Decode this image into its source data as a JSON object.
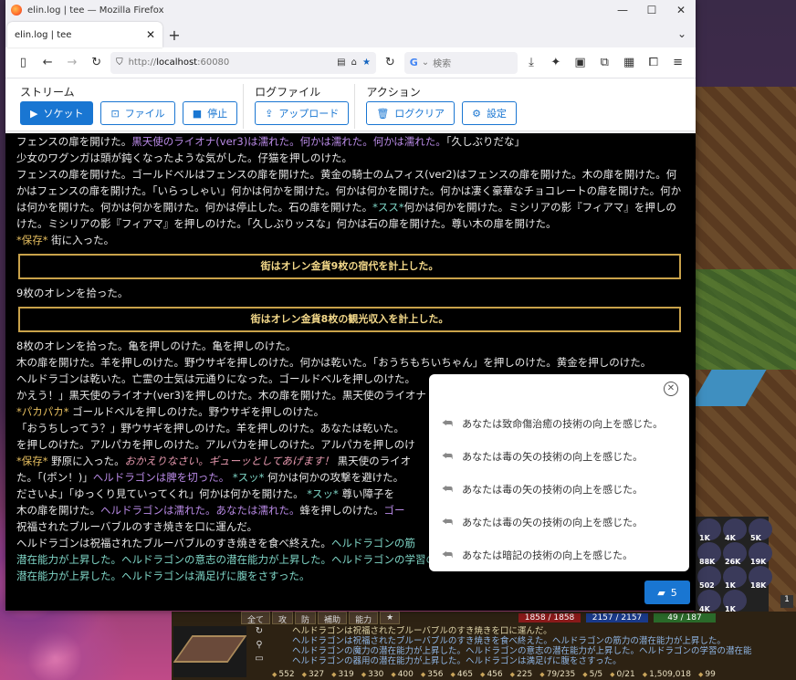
{
  "browser": {
    "window_title": "elin.log | tee — Mozilla Firefox",
    "tab_title": "elin.log | tee",
    "url_protocol": "http://",
    "url_host": "localhost",
    "url_port": ":60080",
    "search_placeholder": "検索"
  },
  "toolbar": {
    "stream": {
      "label": "ストリーム",
      "socket": "ソケット",
      "file": "ファイル",
      "stop": "停止"
    },
    "logfile": {
      "label": "ログファイル",
      "upload": "アップロード"
    },
    "action": {
      "label": "アクション",
      "clear": "ログクリア",
      "settings": "設定"
    }
  },
  "log": {
    "l1a": "フェンスの扉を開けた。",
    "l1b": "黒天使のライオナ(ver3)は濡れた。何かは濡れた。何かは濡れた。",
    "l1c": "「久しぶりだな」",
    "l2": "少女のワグンガは頭が鈍くなったような気がした。仔猫を押しのけた。",
    "l3": "フェンスの扉を開けた。ゴールドベルはフェンスの扉を開けた。黄金の騎士のムフィス(ver2)はフェンスの扉を開けた。木の扉を開けた。何かはフェンスの扉を開けた。「いらっしゃい」何かは何かを開けた。何かは何かを開けた。何かは凄く豪華なチョコレートの扉を開けた。何かは何かを開けた。何かは何かを開けた。何かは停止した。石の扉を開けた。",
    "l3b": "*スス*",
    "l3c": "何かは何かを開けた。ミシリアの影『フィアマ』を押しのけた。ミシリアの影『フィアマ』を押しのけた。「久しぶりッスな」何かは石の扉を開けた。尊い木の扉を開けた。",
    "l4a": "*保存*",
    "l4b": "街に入った。",
    "box1": "街はオレン金貨9枚の宿代を計上した。",
    "l5": "9枚のオレンを拾った。",
    "box2": "街はオレン金貨8枚の観光収入を計上した。",
    "l6": "8枚のオレンを拾った。亀を押しのけた。亀を押しのけた。",
    "l7": "木の扉を開けた。羊を押しのけた。野ウサギを押しのけた。何かは乾いた。「おうちもちいちゃん」を押しのけた。黄金を押しのけた。",
    "l7b": "ヘルドラゴンは乾いた。亡霊の士気は元通りになった。ゴールドベルを押しのけた。",
    "l8": "かえう！」黒天使のライオナ(ver3)を押しのけた。木の扉を開けた。黒天使のライオナ",
    "l9a": "*パカパカ*",
    "l9b": "ゴールドベルを押しのけた。野ウサギを押しのけた。",
    "l10": "「おうちしってう？」野ウサギを押しのけた。羊を押しのけた。あなたは乾いた。",
    "l11": "を押しのけた。アルパカを押しのけた。アルパカを押しのけた。アルパカを押しのけ",
    "l12a": "*保存*",
    "l12b": "野原に入った。",
    "l12c": "おかえりなさい。ギューッとしてあげます！",
    "l12d": "黒天使のライオ",
    "l13a": "た。「(ポン！)」",
    "l13b": "ヘルドラゴンは脾を切った。",
    "l13c": "*スッ*",
    "l13d": "何かは何かの攻撃を避けた。",
    "l14a": "ださいよ」「ゆっくり見ていってくれ」何かは何かを開けた。",
    "l14b": "*スッ*",
    "l14c": "尊い障子を",
    "l15a": "木の扉を開けた。",
    "l15b": "ヘルドラゴンは濡れた。あなたは濡れた。",
    "l15c": "蜂を押しのけた。",
    "l15d": "ゴー",
    "l16": "祝福されたブルーバブルのすき焼きを口に運んだ。",
    "l17a": "ヘルドラゴンは祝福されたブルーバブルのすき焼きを食べ終えた。",
    "l17b": "ヘルドラゴンの筋",
    "l18": "潜在能力が上昇した。ヘルドラゴンの意志の潜在能力が上昇した。ヘルドラゴンの学習の潜在能力が上昇した。ヘルドラゴンの器用の",
    "l19": "潜在能力が上昇した。ヘルドラゴンは満足げに腹をさすった。"
  },
  "popup": {
    "items": [
      "あなたは致命傷治癒の技術の向上を感じた。",
      "あなたは毒の矢の技術の向上を感じた。",
      "あなたは毒の矢の技術の向上を感じた。",
      "あなたは毒の矢の技術の向上を感じた。",
      "あなたは暗記の技術の向上を感じた。"
    ]
  },
  "chat": {
    "count": "5"
  },
  "game": {
    "tabs": [
      "全て",
      "攻",
      "防",
      "補助",
      "能力",
      "★"
    ],
    "hp": "1858 / 1858",
    "mp": "2157 / 2157",
    "sp": "49 / 187",
    "log": [
      "ヘルドラゴンは祝福されたブルーバブルのすき焼きを口に運んだ。",
      "ヘルドラゴンは祝福されたブルーバブルのすき焼きを食べ終えた。ヘルドラゴンの筋力の潜在能力が上昇した。",
      "ヘルドラゴンの魔力の潜在能力が上昇した。ヘルドラゴンの意志の潜在能力が上昇した。ヘルドラゴンの学習の潜在能",
      "ヘルドラゴンの器用の潜在能力が上昇した。ヘルドラゴンは満足げに腹をさすった。"
    ],
    "stats": [
      "552",
      "327",
      "319",
      "330",
      "400",
      "356",
      "465",
      "456",
      "225",
      "79/235",
      "5/5",
      "0/21",
      "1,509,018",
      "99"
    ],
    "slots": [
      "1K",
      "4K",
      "5K",
      "88K",
      "26K",
      "19K",
      "502",
      "1K",
      "18K",
      "4K",
      "1K",
      ""
    ],
    "side_num": "1"
  }
}
